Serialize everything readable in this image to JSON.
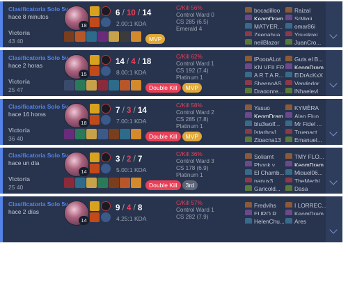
{
  "matches": [
    {
      "queue": "Clasificatoria Solo 5vs5",
      "ago": "hace 8 minutos",
      "result": "Victoria",
      "length": "43 40",
      "level": "18",
      "kills": "6",
      "deaths": "10",
      "assists": "14",
      "kda_ratio": "2.00:1 KDA",
      "badges": [
        {
          "text": "MVP",
          "type": "mvp"
        }
      ],
      "stats": {
        "ckill": "C/Kill 56%",
        "ward": "Control Ward 0",
        "cs": "CS 285 (6.5)",
        "rank": "Emerald 4"
      },
      "team1": [
        "bocadilloo",
        "KeomDram",
        "MATYER...",
        "Zeepahua",
        "neilBlazor"
      ],
      "team2": [
        "Raizal",
        "SrMigii",
        "omar86i",
        "Yisuskrei...",
        "JuanCro..."
      ],
      "me_index": 1,
      "item_colors": [
        "#7a3d1e",
        "#b8562a",
        "#2d6b8a",
        "#6a2b7a",
        "#c8a24a",
        "#3b3b3b",
        "#d28a2c"
      ]
    },
    {
      "queue": "Clasificatoria Solo 5vs5",
      "ago": "hace 2 horas",
      "result": "Victoria",
      "length": "25 47",
      "level": "15",
      "kills": "14",
      "deaths": "4",
      "assists": "18",
      "kda_ratio": "8.00:1 KDA",
      "badges": [
        {
          "text": "Double Kill",
          "type": "dk"
        },
        {
          "text": "MVP",
          "type": "mvp"
        }
      ],
      "stats": {
        "ckill": "C/Kill 62%",
        "ward": "Control Ward 1",
        "cs": "CS 192 (7.4)",
        "rank": "Platinum 1"
      },
      "team1": [
        "lPoopALot",
        "KN VEILER",
        "A R T A R...",
        "SheenoAS",
        "Dragonre..."
      ],
      "team2": [
        "Guts el B...",
        "KeomDram",
        "ElDrAcKxX",
        "Vendedor...",
        "lNhaelevl"
      ],
      "me_index": 6,
      "item_colors": [
        "#3a4a6a",
        "#2a7a5a",
        "#c8a24a",
        "#8a2a3a",
        "#2d6b8a",
        "#b8562a",
        "#d28a2c"
      ]
    },
    {
      "queue": "Clasificatoria Solo 5vs5",
      "ago": "hace 16 horas",
      "result": "Victoria",
      "length": "36 40",
      "level": "18",
      "kills": "7",
      "deaths": "3",
      "assists": "14",
      "kda_ratio": "7.00:1 KDA",
      "badges": [
        {
          "text": "Double Kill",
          "type": "dk"
        },
        {
          "text": "MVP",
          "type": "mvp"
        }
      ],
      "stats": {
        "ckill": "C/Kill 58%",
        "ward": "Control Ward 2",
        "cs": "CS 285 (7.8)",
        "rank": "Platinum 1"
      },
      "team1": [
        "Yasuo",
        "KeomDram",
        "blu3wolf...",
        "[starboy]",
        "Zipacna13"
      ],
      "team2": [
        "KYMÈRA",
        "Alan Fluo...",
        "Mr Fidel ...",
        "Truepact",
        "Emanuel..."
      ],
      "me_index": 1,
      "item_colors": [
        "#6a2b7a",
        "#2a7a5a",
        "#c8a24a",
        "#3b5a8a",
        "#7a3d1e",
        "#2d6b8a",
        "#d28a2c"
      ]
    },
    {
      "queue": "Clasificatoria Solo 5vs5",
      "ago": "hace un día",
      "result": "Victoria",
      "length": "25 40",
      "level": "14",
      "kills": "3",
      "deaths": "2",
      "assists": "7",
      "kda_ratio": "5.00:1 KDA",
      "badges": [
        {
          "text": "Double Kill",
          "type": "dk"
        },
        {
          "text": "3rd",
          "type": "rank"
        }
      ],
      "stats": {
        "ckill": "C/Kill 36%",
        "ward": "Control Ward 3",
        "cs": "CS 178 (6.9)",
        "rank": "Platinum 1"
      },
      "team1": [
        "Soljarnt",
        "Phonk y ...",
        "El Chamb...",
        "papux3",
        "Garicold..."
      ],
      "team2": [
        "TMY FLO...",
        "KeomDram",
        "Miguel06...",
        "TheMechi",
        "Dasa"
      ],
      "me_index": 6,
      "item_colors": [
        "#8a2a3a",
        "#2d6b8a",
        "#c8a24a",
        "#2a7a5a",
        "#7a3d1e",
        "#b8562a",
        "#d28a2c"
      ]
    },
    {
      "queue": "Clasificatoria Solo 5vs5",
      "ago": "hace 2 días",
      "result": "",
      "length": "",
      "level": "14",
      "kills": "9",
      "deaths": "4",
      "assists": "8",
      "kda_ratio": "4.25:1 KDA",
      "badges": [],
      "stats": {
        "ckill": "C/Kill 57%",
        "ward": "Control Ward 1",
        "cs": "CS 282 (7.9)",
        "rank": ""
      },
      "team1": [
        "Fredyjhs",
        "EURO R",
        "HelenChu..."
      ],
      "team2": [
        "I LORREC...",
        "KeomDram",
        "Ares"
      ],
      "me_index": 4,
      "item_colors": []
    }
  ],
  "colors": {
    "accent": "#5383e8",
    "card": "#28344e",
    "deaths": "#e84057",
    "mvp": "#e0a93a"
  },
  "icons": {
    "expand": "chevron-down-icon",
    "champion": "champion-portrait-icon",
    "spell_1": "flash-spell-icon",
    "spell_2": "ignite-spell-icon",
    "rune_1": "keystone-rune-icon",
    "rune_2": "secondary-rune-icon"
  }
}
